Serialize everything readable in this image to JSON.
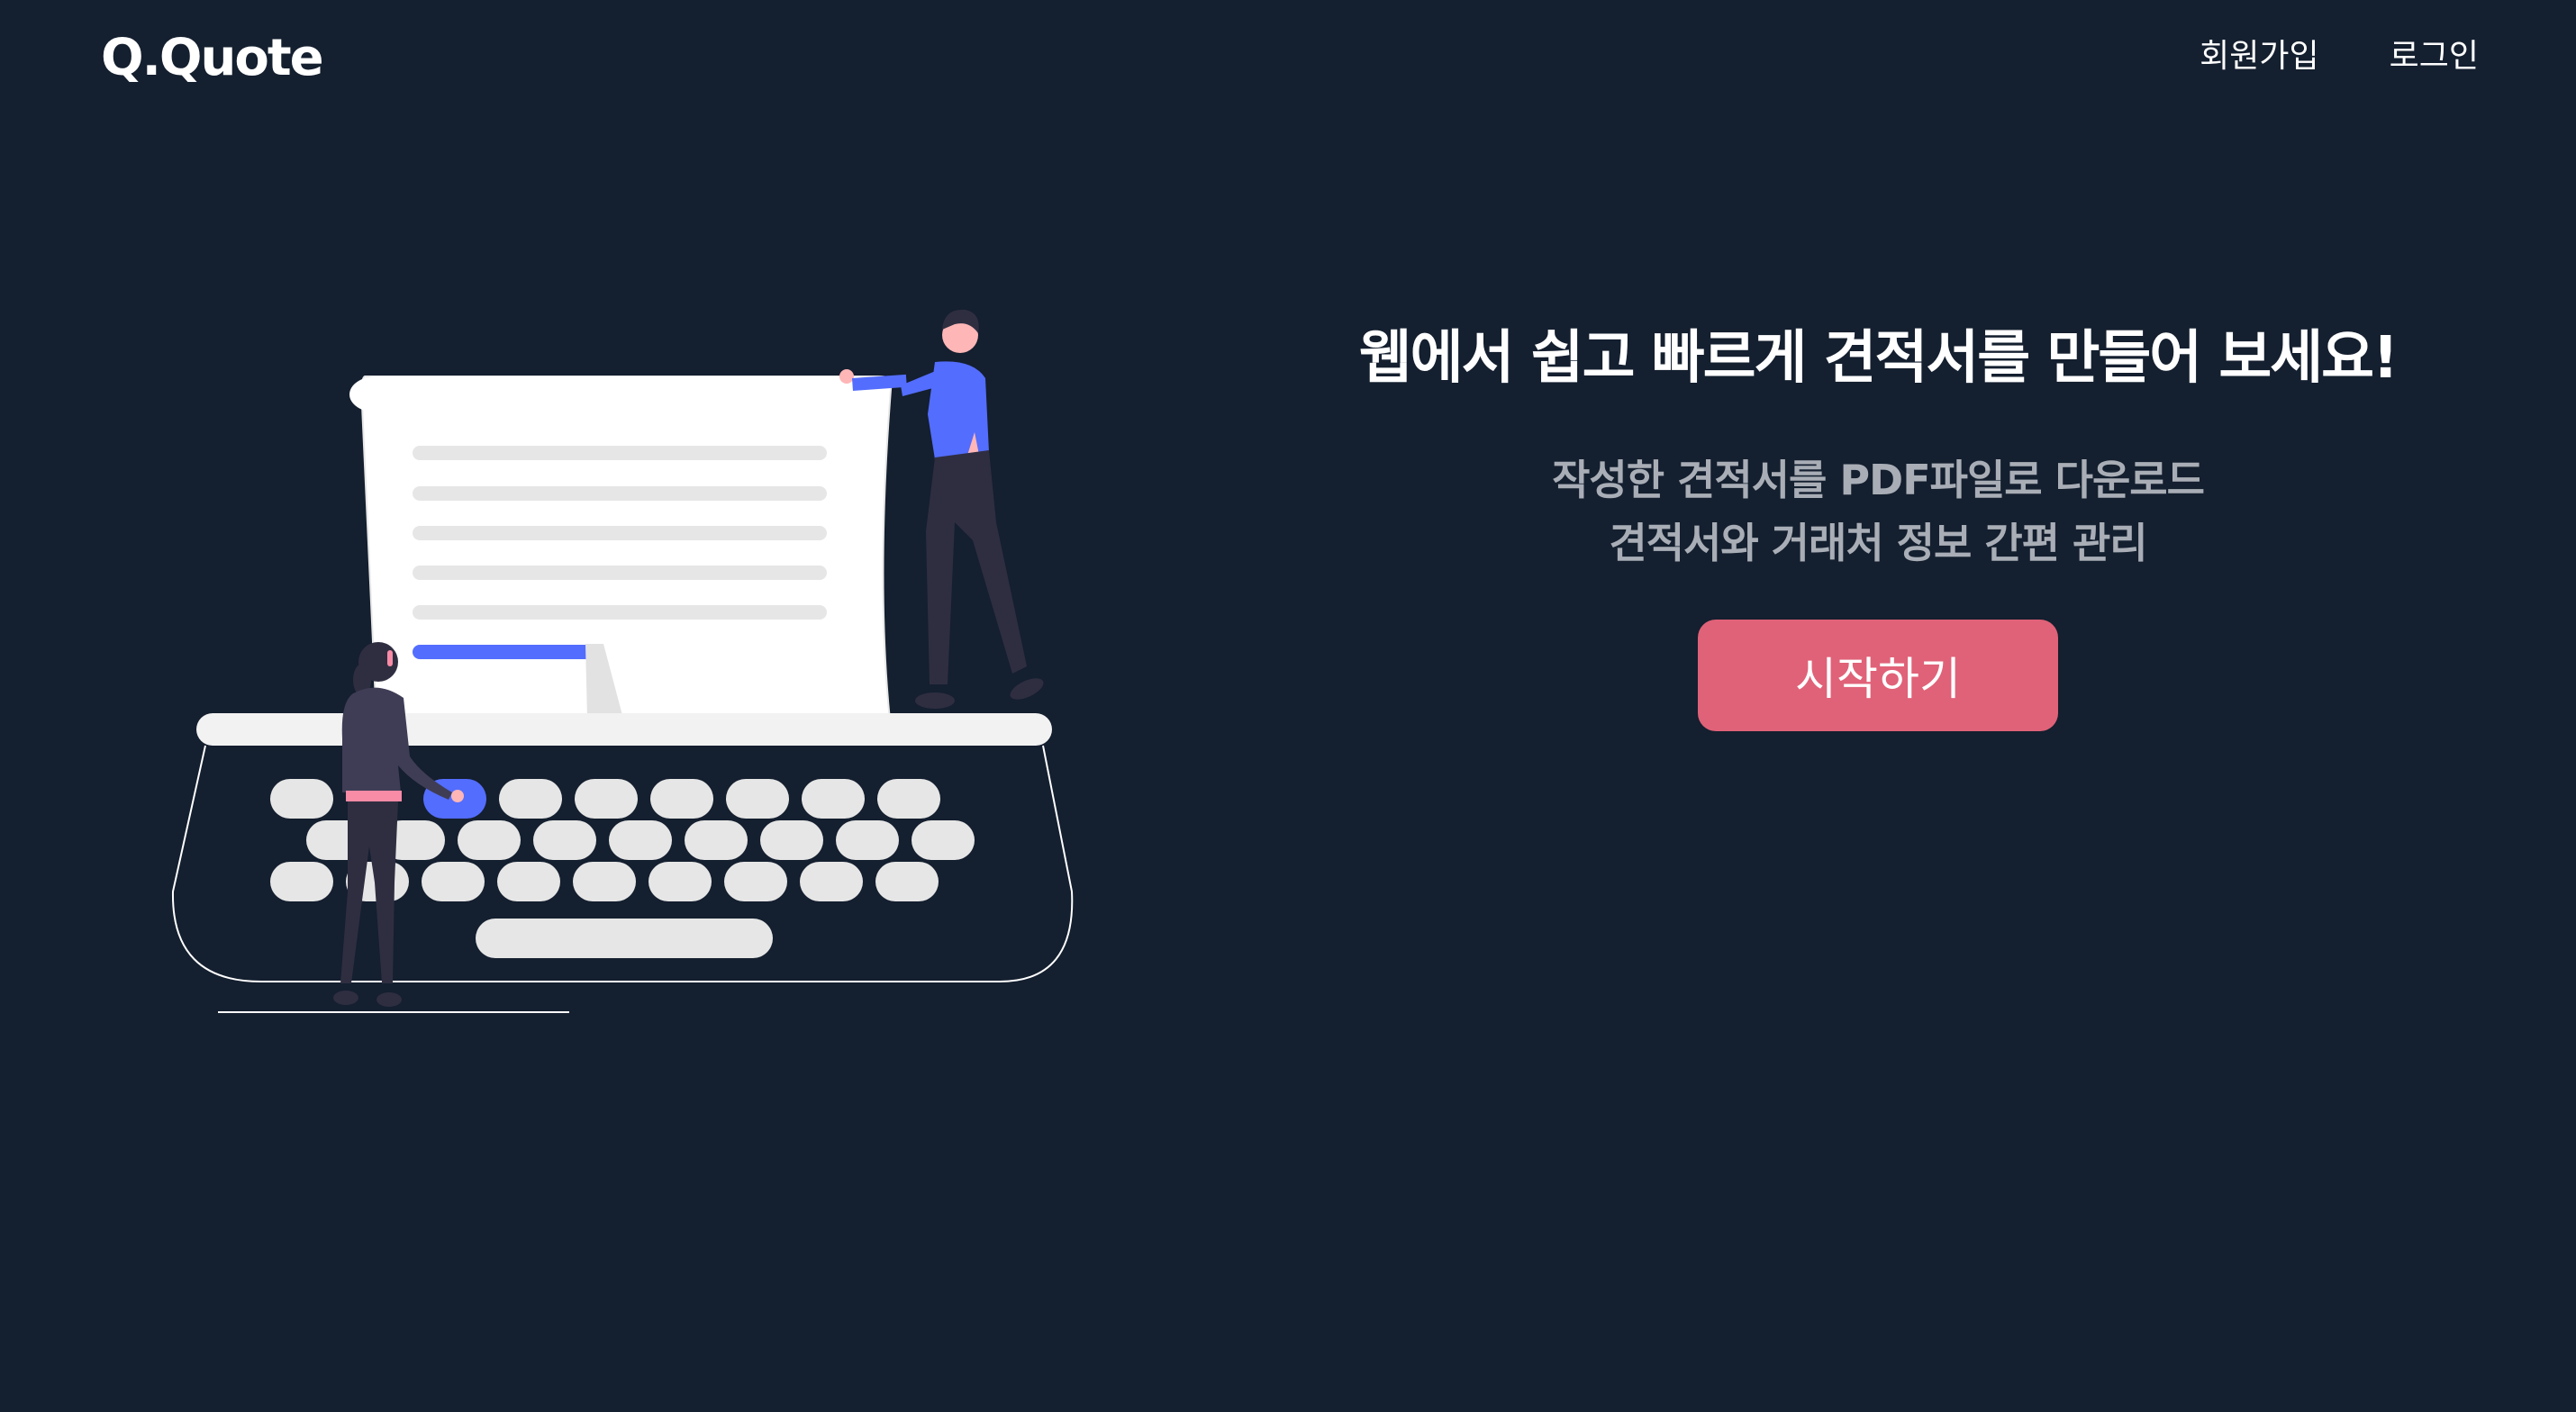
{
  "header": {
    "logo": "Q.Quote",
    "nav": {
      "signup_label": "회원가입",
      "login_label": "로그인"
    }
  },
  "hero": {
    "headline": "웹에서 쉽고 빠르게 견적서를 만들어 보세요!",
    "sub_line_1": "작성한 견적서를 PDF파일로 다운로드",
    "sub_line_2": "견적서와 거래처 정보 간편 관리",
    "cta_label": "시작하기"
  },
  "illustration": {
    "icon": "typewriter-illustration"
  },
  "colors": {
    "background": "#141f2f",
    "accent": "#e06278",
    "figure_blue": "#536dfe",
    "muted_text": "#a9aeb6"
  }
}
